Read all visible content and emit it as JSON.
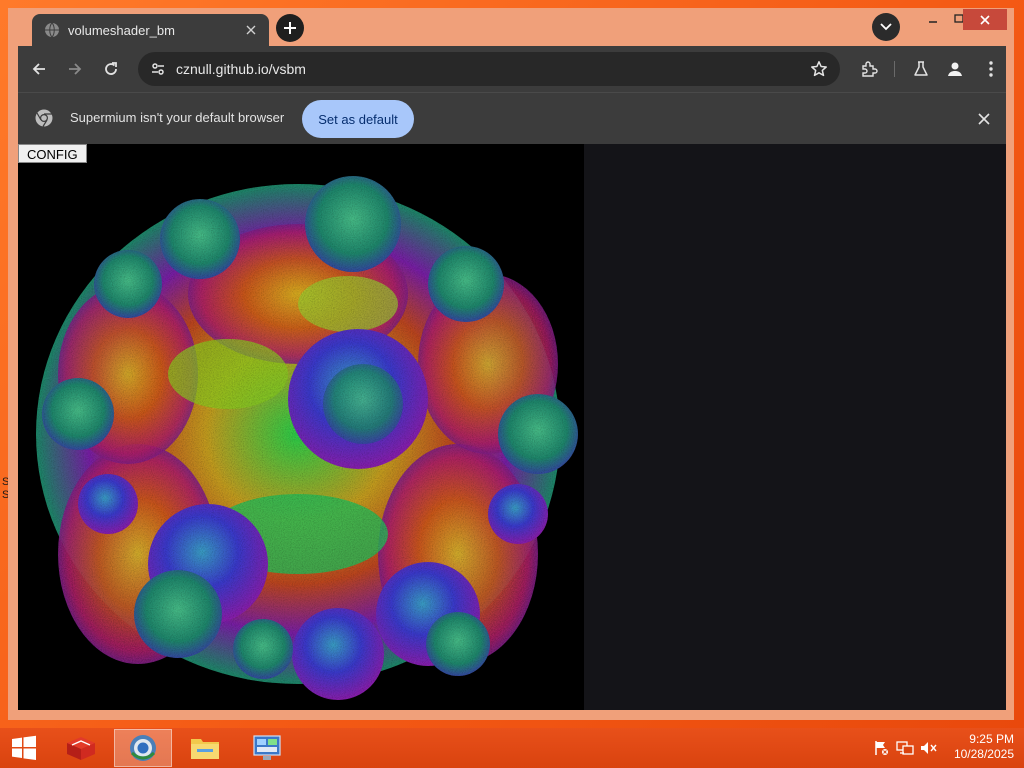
{
  "desktop": {
    "edge_glyphs": [
      "S",
      "S"
    ]
  },
  "browser": {
    "tab": {
      "title": "volumeshader_bm",
      "favicon": "globe-icon"
    },
    "omnibox": {
      "url": "cznull.github.io/vsbm"
    },
    "infobar": {
      "message": "Supermium isn't your default browser",
      "button_label": "Set as default"
    },
    "colors": {
      "frame": "#f0a07a",
      "toolbar": "#3c3c3c",
      "accent_button": "#a8c7fa",
      "close_red": "#c7493b"
    }
  },
  "page": {
    "config_button": "CONFIG",
    "render": "volume shader fractal (mandelbulb-like)"
  },
  "taskbar": {
    "items": [
      "start-icon",
      "app-icon-red-box",
      "browser-icon",
      "file-explorer-icon",
      "control-panel-icon"
    ],
    "active_item": "browser-icon",
    "tray": [
      "action-center-flag-icon",
      "network-icon",
      "volume-muted-icon"
    ],
    "time": "9:25 PM",
    "date": "10/28/2025"
  }
}
